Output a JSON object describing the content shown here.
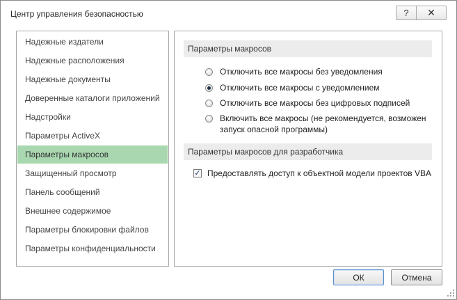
{
  "window": {
    "title": "Центр управления безопасностью"
  },
  "titlebar": {
    "help_label": "?",
    "close_label": "✕"
  },
  "sidebar": {
    "items": [
      {
        "label": "Надежные издатели"
      },
      {
        "label": "Надежные расположения"
      },
      {
        "label": "Надежные документы"
      },
      {
        "label": "Доверенные каталоги приложений"
      },
      {
        "label": "Надстройки"
      },
      {
        "label": "Параметры ActiveX"
      },
      {
        "label": "Параметры макросов",
        "selected": true
      },
      {
        "label": "Защищенный просмотр"
      },
      {
        "label": "Панель сообщений"
      },
      {
        "label": "Внешнее содержимое"
      },
      {
        "label": "Параметры блокировки файлов"
      },
      {
        "label": "Параметры конфиденциальности"
      }
    ]
  },
  "macros": {
    "header": "Параметры макросов",
    "options": [
      {
        "label": "Отключить все макросы без уведомления",
        "checked": false
      },
      {
        "label": "Отключить все макросы с уведомлением",
        "checked": true
      },
      {
        "label": "Отключить все макросы без цифровых подписей",
        "checked": false
      },
      {
        "label_line1": "Включить все макросы (не рекомендуется, возможен",
        "label_line2": "запуск опасной программы)",
        "checked": false
      }
    ]
  },
  "developer": {
    "header": "Параметры макросов для разработчика",
    "vba_access_label": "Предоставлять доступ к объектной модели проектов VBA",
    "vba_access_checked": true,
    "check_mark": "✓"
  },
  "footer": {
    "ok_label": "ОК",
    "cancel_label": "Отмена"
  },
  "colors": {
    "selected_item": "#a9d8b0",
    "section_header": "#ececec"
  }
}
